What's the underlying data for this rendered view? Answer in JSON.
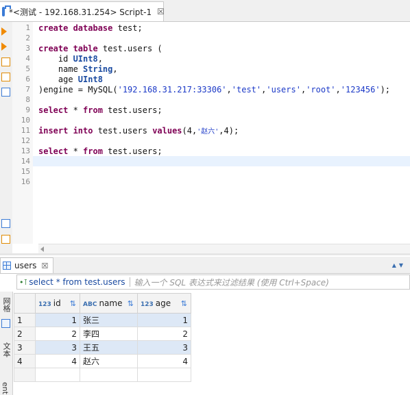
{
  "editor": {
    "tab_title": "*<测试 - 192.168.31.254> Script-1",
    "close_glyph": "☒",
    "line_numbers": [
      "1",
      "2",
      "3",
      "4",
      "5",
      "6",
      "7",
      "8",
      "9",
      "10",
      "11",
      "12",
      "13",
      "14",
      "15",
      "16"
    ]
  },
  "code": {
    "l1_kw": "create database",
    "l1_rest": " test;",
    "l3_kw": "create table",
    "l3_rest": " test.users (",
    "l4_a": "    id ",
    "l4_t": "UInt8",
    "l4_c": ",",
    "l5_a": "    name ",
    "l5_t": "String",
    "l5_c": ",",
    "l6_a": "    age ",
    "l6_t": "UInt8",
    "l7_a": ")engine = MySQL(",
    "l7_s1": "'192.168.31.217:33306'",
    "l7_c1": ",",
    "l7_s2": "'test'",
    "l7_c2": ",",
    "l7_s3": "'users'",
    "l7_c3": ",",
    "l7_s4": "'root'",
    "l7_c4": ",",
    "l7_s5": "'123456'",
    "l7_end": ");",
    "l9_kw1": "select",
    "l9_m": " * ",
    "l9_kw2": "from",
    "l9_rest": " test.users;",
    "l11_kw1": "insert into",
    "l11_m": " test.users ",
    "l11_kw2": "values",
    "l11_a": "(4,",
    "l11_s": "'赵六'",
    "l11_b": ",4);",
    "l13_kw1": "select",
    "l13_m": " * ",
    "l13_kw2": "from",
    "l13_rest": " test.users;"
  },
  "results": {
    "tab_label": "users",
    "close_glyph": "☒",
    "filter_icon": "•⊺",
    "query": "select * from test.users",
    "filter_placeholder": "输入一个 SQL 表达式来过滤结果 (使用 Ctrl+Space)",
    "side_tabs": [
      "网格",
      "文本",
      "ent"
    ],
    "columns": [
      {
        "type": "123",
        "name": "id"
      },
      {
        "type": "ABC",
        "name": "name"
      },
      {
        "type": "123",
        "name": "age"
      }
    ],
    "rows": [
      {
        "n": "1",
        "id": "1",
        "name": "张三",
        "age": "1"
      },
      {
        "n": "2",
        "id": "2",
        "name": "李四",
        "age": "2"
      },
      {
        "n": "3",
        "id": "3",
        "name": "王五",
        "age": "3"
      },
      {
        "n": "4",
        "id": "4",
        "name": "赵六",
        "age": "4"
      }
    ]
  },
  "icons": {
    "sort": "⇅",
    "panel_arrows": "▲▼"
  }
}
